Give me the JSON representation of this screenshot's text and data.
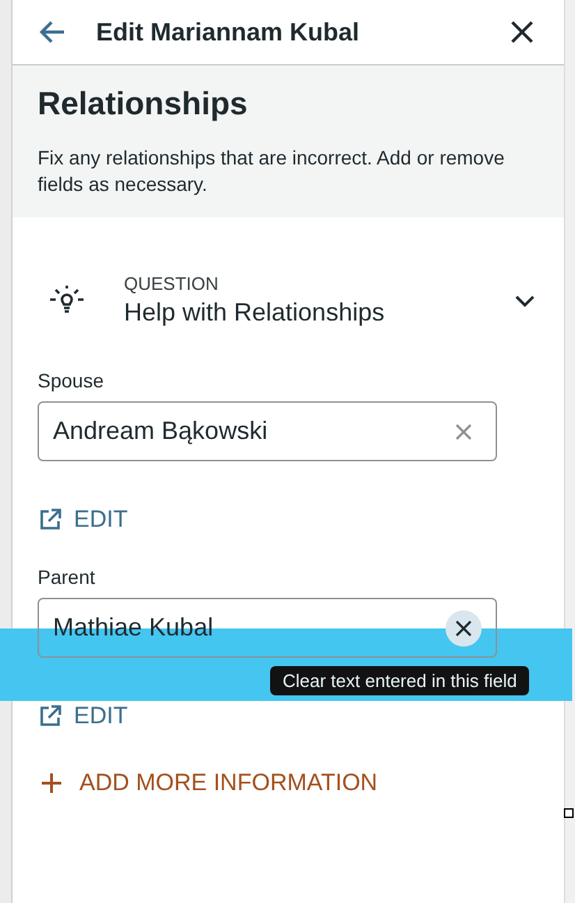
{
  "header": {
    "title": "Edit Mariannam Kubal"
  },
  "section": {
    "title": "Relationships",
    "description": "Fix any relationships that are incorrect. Add or remove fields as necessary."
  },
  "question": {
    "label": "QUESTION",
    "title": "Help with Relationships",
    "expanded": false
  },
  "fields": [
    {
      "label": "Spouse",
      "value": "Andream Bąkowski",
      "clear_hovered": false,
      "link": "EDIT"
    },
    {
      "label": "Parent",
      "value": "Mathiae Kubal",
      "clear_hovered": true,
      "link": "EDIT"
    }
  ],
  "tooltip": "Clear text entered in this field",
  "add_button": "ADD MORE INFORMATION"
}
